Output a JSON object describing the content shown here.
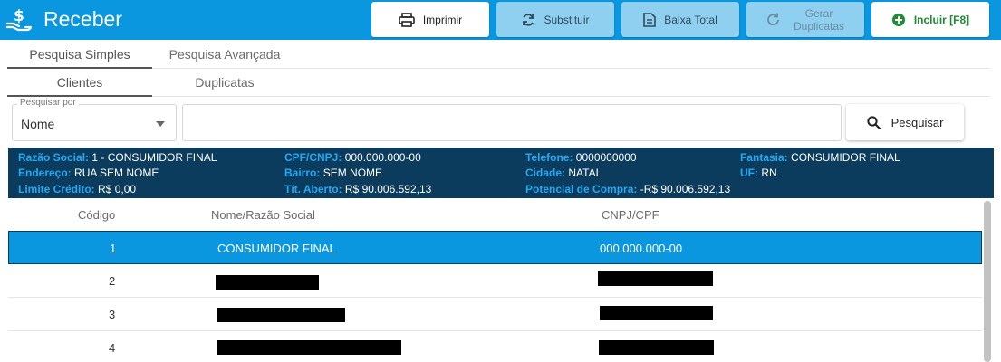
{
  "header": {
    "title": "Receber",
    "logo_icon": "hand-dollar-icon",
    "buttons": {
      "print": {
        "label": "Imprimir",
        "icon": "printer-icon"
      },
      "replace": {
        "label": "Substituir",
        "icon": "refresh-icon"
      },
      "write_off": {
        "label": "Baixa Total",
        "icon": "document-icon"
      },
      "generate_line1": "Gerar",
      "generate_line2": "Duplicatas",
      "include": {
        "label": "Incluir [F8]",
        "icon": "plus-circle-icon"
      }
    },
    "colors": {
      "bar": "#0a97e0",
      "include_text": "#1f8b35"
    }
  },
  "tabs_primary": {
    "simple": "Pesquisa Simples",
    "advanced": "Pesquisa Avançada",
    "active": "simple"
  },
  "tabs_secondary": {
    "clients": "Clientes",
    "duplicates": "Duplicatas",
    "active": "clients"
  },
  "search": {
    "field_label": "Pesquisar por",
    "field_value": "Nome",
    "input_value": "",
    "button_label": "Pesquisar"
  },
  "client_info": {
    "razao_social_label": "Razão Social:",
    "razao_social": "1 - CONSUMIDOR FINAL",
    "cpf_label": "CPF/CNPJ:",
    "cpf": "000.000.000-00",
    "telefone_label": "Telefone:",
    "telefone": "0000000000",
    "fantasia_label": "Fantasia:",
    "fantasia": "CONSUMIDOR FINAL",
    "endereco_label": "Endereço:",
    "endereco": "RUA SEM NOME",
    "bairro_label": "Bairro:",
    "bairro": "SEM NOME",
    "cidade_label": "Cidade:",
    "cidade": "NATAL",
    "uf_label": "UF:",
    "uf": "RN",
    "limite_label": "Limite Crédito:",
    "limite": "R$ 0,00",
    "tit_label": "Tít. Aberto:",
    "tit": "R$ 90.006.592,13",
    "potencial_label": "Potencial de Compra:",
    "potencial": "-R$ 90.006.592,13"
  },
  "table": {
    "columns": {
      "code": "Código",
      "name": "Nome/Razão Social",
      "doc": "CNPJ/CPF"
    },
    "rows": [
      {
        "code": "1",
        "name": "CONSUMIDOR FINAL",
        "doc": "000.000.000-00",
        "selected": true
      },
      {
        "code": "2",
        "name": "",
        "doc": "",
        "redacted": true
      },
      {
        "code": "3",
        "name": "",
        "doc": "",
        "redacted": true
      },
      {
        "code": "4",
        "name": "",
        "doc": "",
        "redacted": true
      }
    ]
  }
}
